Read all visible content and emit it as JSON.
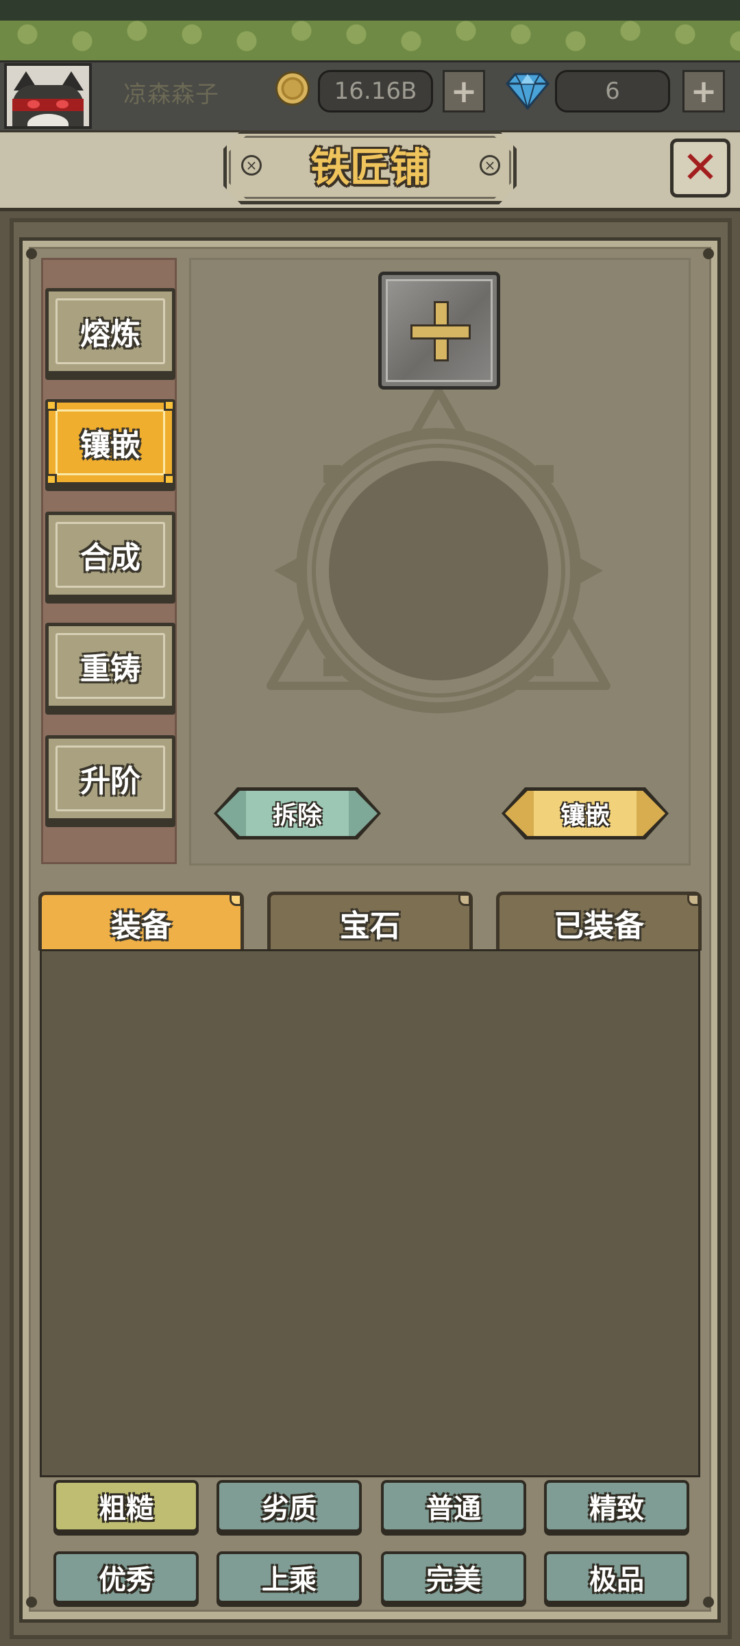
{
  "status_bar": {
    "player_name": "凉森森子",
    "coins": "16.16B",
    "gems": "6",
    "coin_icon": "gold-coin-icon",
    "gem_icon": "diamond-icon",
    "plus_icon": "plus-icon"
  },
  "header": {
    "title": "铁匠铺",
    "close_icon": "close-x-icon",
    "close_color": "#a31f1f"
  },
  "side_tabs": [
    {
      "label": "熔炼",
      "active": false
    },
    {
      "label": "镶嵌",
      "active": true
    },
    {
      "label": "合成",
      "active": false
    },
    {
      "label": "重铸",
      "active": false
    },
    {
      "label": "升阶",
      "active": false
    }
  ],
  "work_area": {
    "add_slot_icon": "plus-icon",
    "socket_icon": "gem-socket-emblem-icon",
    "remove_label": "拆除",
    "inlay_label": "镶嵌"
  },
  "inventory_tabs": [
    {
      "label": "装备",
      "active": true
    },
    {
      "label": "宝石",
      "active": false
    },
    {
      "label": "已装备",
      "active": false
    }
  ],
  "filters": [
    {
      "label": "粗糙",
      "active": true
    },
    {
      "label": "劣质",
      "active": false
    },
    {
      "label": "普通",
      "active": false
    },
    {
      "label": "精致",
      "active": false
    },
    {
      "label": "优秀",
      "active": false
    },
    {
      "label": "上乘",
      "active": false
    },
    {
      "label": "完美",
      "active": false
    },
    {
      "label": "极品",
      "active": false
    }
  ],
  "colors": {
    "accent_gold": "#f0ae2e",
    "title_gold": "#f0c45c",
    "filter_teal": "#7f9c95",
    "filter_active": "#bebd72",
    "remove_teal": "#86b3a2",
    "inlay_gold": "#e8c46a"
  }
}
